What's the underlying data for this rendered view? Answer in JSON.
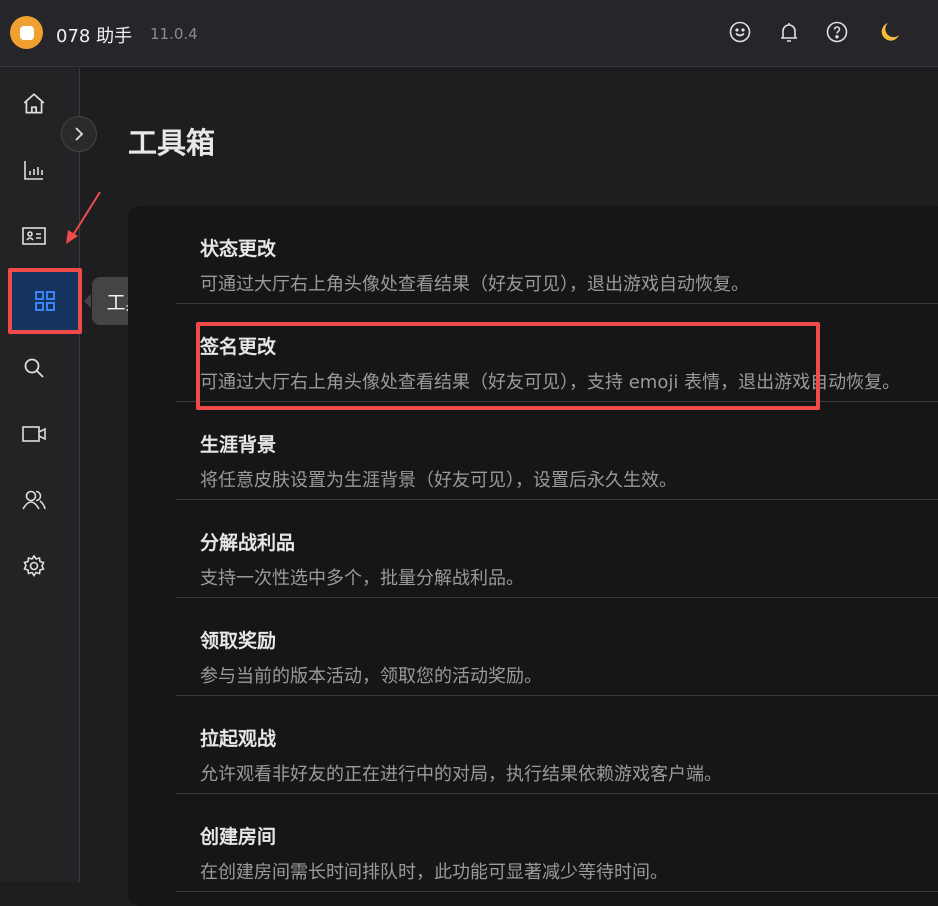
{
  "app": {
    "name": "078 助手",
    "version": "11.0.4"
  },
  "header_icons": [
    "smile-icon",
    "bell-icon",
    "help-icon",
    "moon-icon"
  ],
  "sidebar": {
    "items": [
      "home",
      "stats",
      "profile-card",
      "toolbox",
      "search",
      "video",
      "friends",
      "settings"
    ],
    "active": "toolbox",
    "tooltip": "工具箱"
  },
  "page": {
    "title": "工具箱"
  },
  "tools": [
    {
      "name": "状态更改",
      "desc": "可通过大厅右上角头像处查看结果（好友可见），退出游戏自动恢复。"
    },
    {
      "name": "签名更改",
      "desc": "可通过大厅右上角头像处查看结果（好友可见），支持 emoji 表情，退出游戏自动恢复。"
    },
    {
      "name": "生涯背景",
      "desc": "将任意皮肤设置为生涯背景（好友可见），设置后永久生效。"
    },
    {
      "name": "分解战利品",
      "desc": "支持一次性选中多个，批量分解战利品。"
    },
    {
      "name": "领取奖励",
      "desc": "参与当前的版本活动，领取您的活动奖励。"
    },
    {
      "name": "拉起观战",
      "desc": "允许观看非好友的正在进行中的对局，执行结果依赖游戏客户端。"
    },
    {
      "name": "创建房间",
      "desc": "在创建房间需长时间排队时，此功能可显著减少等待时间。"
    }
  ],
  "colors": {
    "accent": "#3b82f6",
    "highlight": "#f04a4a",
    "logo": "#f0a030",
    "moon": "#f6b93b"
  }
}
